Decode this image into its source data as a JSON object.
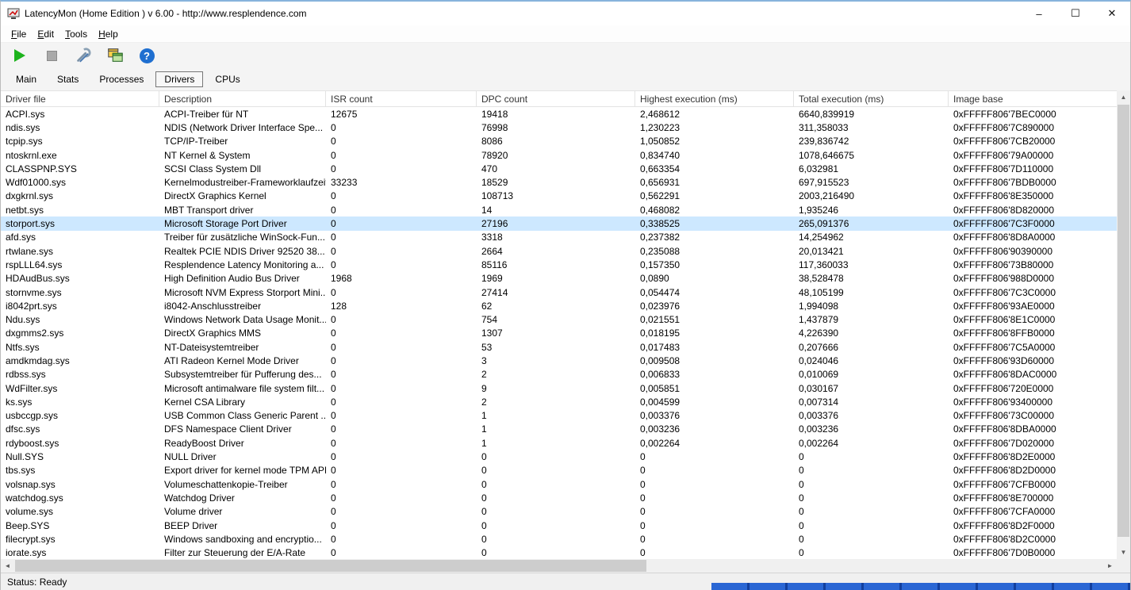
{
  "window": {
    "title": "LatencyMon  (Home Edition )  v 6.00 - http://www.resplendence.com",
    "controls": [
      "minimize",
      "maximize",
      "close"
    ]
  },
  "menu": {
    "items": [
      "File",
      "Edit",
      "Tools",
      "Help"
    ]
  },
  "toolbar": {
    "icons": [
      "play-icon",
      "stop-icon",
      "tools-icon",
      "windows-icon",
      "help-icon"
    ]
  },
  "tabs": {
    "items": [
      "Main",
      "Stats",
      "Processes",
      "Drivers",
      "CPUs"
    ],
    "active": "Drivers"
  },
  "table": {
    "columns": [
      "Driver file",
      "Description",
      "ISR count",
      "DPC count",
      "Highest execution (ms)",
      "Total execution (ms)",
      "Image base"
    ],
    "selected_row": 8,
    "rows": [
      [
        "ACPI.sys",
        "ACPI-Treiber für NT",
        "12675",
        "19418",
        "2,468612",
        "6640,839919",
        "0xFFFFF806'7BEC0000"
      ],
      [
        "ndis.sys",
        "NDIS (Network Driver Interface Spe...",
        "0",
        "76998",
        "1,230223",
        "311,358033",
        "0xFFFFF806'7C890000"
      ],
      [
        "tcpip.sys",
        "TCP/IP-Treiber",
        "0",
        "8086",
        "1,050852",
        "239,836742",
        "0xFFFFF806'7CB20000"
      ],
      [
        "ntoskrnl.exe",
        "NT Kernel & System",
        "0",
        "78920",
        "0,834740",
        "1078,646675",
        "0xFFFFF806'79A00000"
      ],
      [
        "CLASSPNP.SYS",
        "SCSI Class System Dll",
        "0",
        "470",
        "0,663354",
        "6,032981",
        "0xFFFFF806'7D110000"
      ],
      [
        "Wdf01000.sys",
        "Kernelmodustreiber-Frameworklaufzeit",
        "33233",
        "18529",
        "0,656931",
        "697,915523",
        "0xFFFFF806'7BDB0000"
      ],
      [
        "dxgkrnl.sys",
        "DirectX Graphics Kernel",
        "0",
        "108713",
        "0,562291",
        "2003,216490",
        "0xFFFFF806'8E350000"
      ],
      [
        "netbt.sys",
        "MBT Transport driver",
        "0",
        "14",
        "0,468082",
        "1,935246",
        "0xFFFFF806'8D820000"
      ],
      [
        "storport.sys",
        "Microsoft Storage Port Driver",
        "0",
        "27196",
        "0,338525",
        "265,091376",
        "0xFFFFF806'7C3F0000"
      ],
      [
        "afd.sys",
        "Treiber für zusätzliche WinSock-Fun...",
        "0",
        "3318",
        "0,237382",
        "14,254962",
        "0xFFFFF806'8D8A0000"
      ],
      [
        "rtwlane.sys",
        "Realtek PCIE NDIS Driver 92520 38...",
        "0",
        "2664",
        "0,235088",
        "20,013421",
        "0xFFFFF806'90390000"
      ],
      [
        "rspLLL64.sys",
        "Resplendence Latency Monitoring a...",
        "0",
        "85116",
        "0,157350",
        "117,360033",
        "0xFFFFF806'73B80000"
      ],
      [
        "HDAudBus.sys",
        "High Definition Audio Bus Driver",
        "1968",
        "1969",
        "0,0890",
        "38,528478",
        "0xFFFFF806'988D0000"
      ],
      [
        "stornvme.sys",
        "Microsoft NVM Express Storport Mini...",
        "0",
        "27414",
        "0,054474",
        "48,105199",
        "0xFFFFF806'7C3C0000"
      ],
      [
        "i8042prt.sys",
        "i8042-Anschlusstreiber",
        "128",
        "62",
        "0,023976",
        "1,994098",
        "0xFFFFF806'93AE0000"
      ],
      [
        "Ndu.sys",
        "Windows Network Data Usage Monit...",
        "0",
        "754",
        "0,021551",
        "1,437879",
        "0xFFFFF806'8E1C0000"
      ],
      [
        "dxgmms2.sys",
        "DirectX Graphics MMS",
        "0",
        "1307",
        "0,018195",
        "4,226390",
        "0xFFFFF806'8FFB0000"
      ],
      [
        "Ntfs.sys",
        "NT-Dateisystemtreiber",
        "0",
        "53",
        "0,017483",
        "0,207666",
        "0xFFFFF806'7C5A0000"
      ],
      [
        "amdkmdag.sys",
        "ATI Radeon Kernel Mode Driver",
        "0",
        "3",
        "0,009508",
        "0,024046",
        "0xFFFFF806'93D60000"
      ],
      [
        "rdbss.sys",
        "Subsystemtreiber für Pufferung des...",
        "0",
        "2",
        "0,006833",
        "0,010069",
        "0xFFFFF806'8DAC0000"
      ],
      [
        "WdFilter.sys",
        "Microsoft antimalware file system filt...",
        "0",
        "9",
        "0,005851",
        "0,030167",
        "0xFFFFF806'720E0000"
      ],
      [
        "ks.sys",
        "Kernel CSA Library",
        "0",
        "2",
        "0,004599",
        "0,007314",
        "0xFFFFF806'93400000"
      ],
      [
        "usbccgp.sys",
        "USB Common Class Generic Parent ...",
        "0",
        "1",
        "0,003376",
        "0,003376",
        "0xFFFFF806'73C00000"
      ],
      [
        "dfsc.sys",
        "DFS Namespace Client Driver",
        "0",
        "1",
        "0,003236",
        "0,003236",
        "0xFFFFF806'8DBA0000"
      ],
      [
        "rdyboost.sys",
        "ReadyBoost Driver",
        "0",
        "1",
        "0,002264",
        "0,002264",
        "0xFFFFF806'7D020000"
      ],
      [
        "Null.SYS",
        "NULL Driver",
        "0",
        "0",
        "0",
        "0",
        "0xFFFFF806'8D2E0000"
      ],
      [
        "tbs.sys",
        "Export driver for kernel mode TPM API",
        "0",
        "0",
        "0",
        "0",
        "0xFFFFF806'8D2D0000"
      ],
      [
        "volsnap.sys",
        "Volumeschattenkopie-Treiber",
        "0",
        "0",
        "0",
        "0",
        "0xFFFFF806'7CFB0000"
      ],
      [
        "watchdog.sys",
        "Watchdog Driver",
        "0",
        "0",
        "0",
        "0",
        "0xFFFFF806'8E700000"
      ],
      [
        "volume.sys",
        "Volume driver",
        "0",
        "0",
        "0",
        "0",
        "0xFFFFF806'7CFA0000"
      ],
      [
        "Beep.SYS",
        "BEEP Driver",
        "0",
        "0",
        "0",
        "0",
        "0xFFFFF806'8D2F0000"
      ],
      [
        "filecrypt.sys",
        "Windows sandboxing and encryptio...",
        "0",
        "0",
        "0",
        "0",
        "0xFFFFF806'8D2C0000"
      ],
      [
        "iorate.sys",
        "Filter zur Steuerung der E/A-Rate",
        "0",
        "0",
        "0",
        "0",
        "0xFFFFF806'7D0B0000"
      ]
    ]
  },
  "statusbar": {
    "text": "Status: Ready"
  }
}
